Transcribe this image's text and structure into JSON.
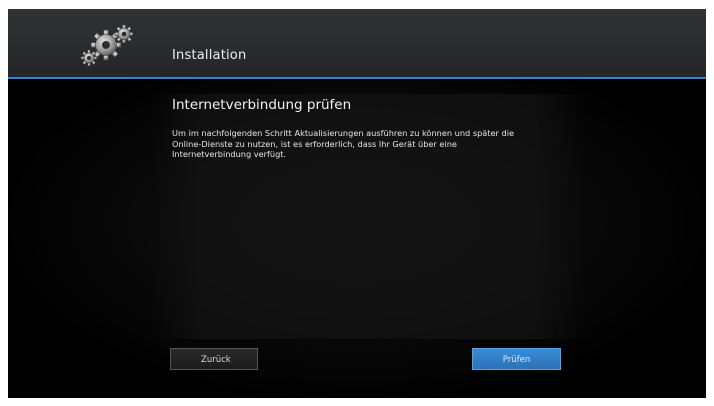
{
  "header": {
    "title": "Installation",
    "icon": "gears-icon"
  },
  "main": {
    "heading": "Internetverbindung prüfen",
    "description_lines": [
      "Um im nachfolgenden Schritt Aktualisierungen ausführen zu können und später die",
      "Online-Dienste zu nutzen, ist es erforderlich, dass Ihr Gerät über eine",
      "Internetverbindung verfügt."
    ]
  },
  "buttons": {
    "back_label": "Zurück",
    "check_label": "Prüfen"
  },
  "colors": {
    "accent": "#3b82c4",
    "button_active": "#3380cc",
    "background": "#000000"
  }
}
